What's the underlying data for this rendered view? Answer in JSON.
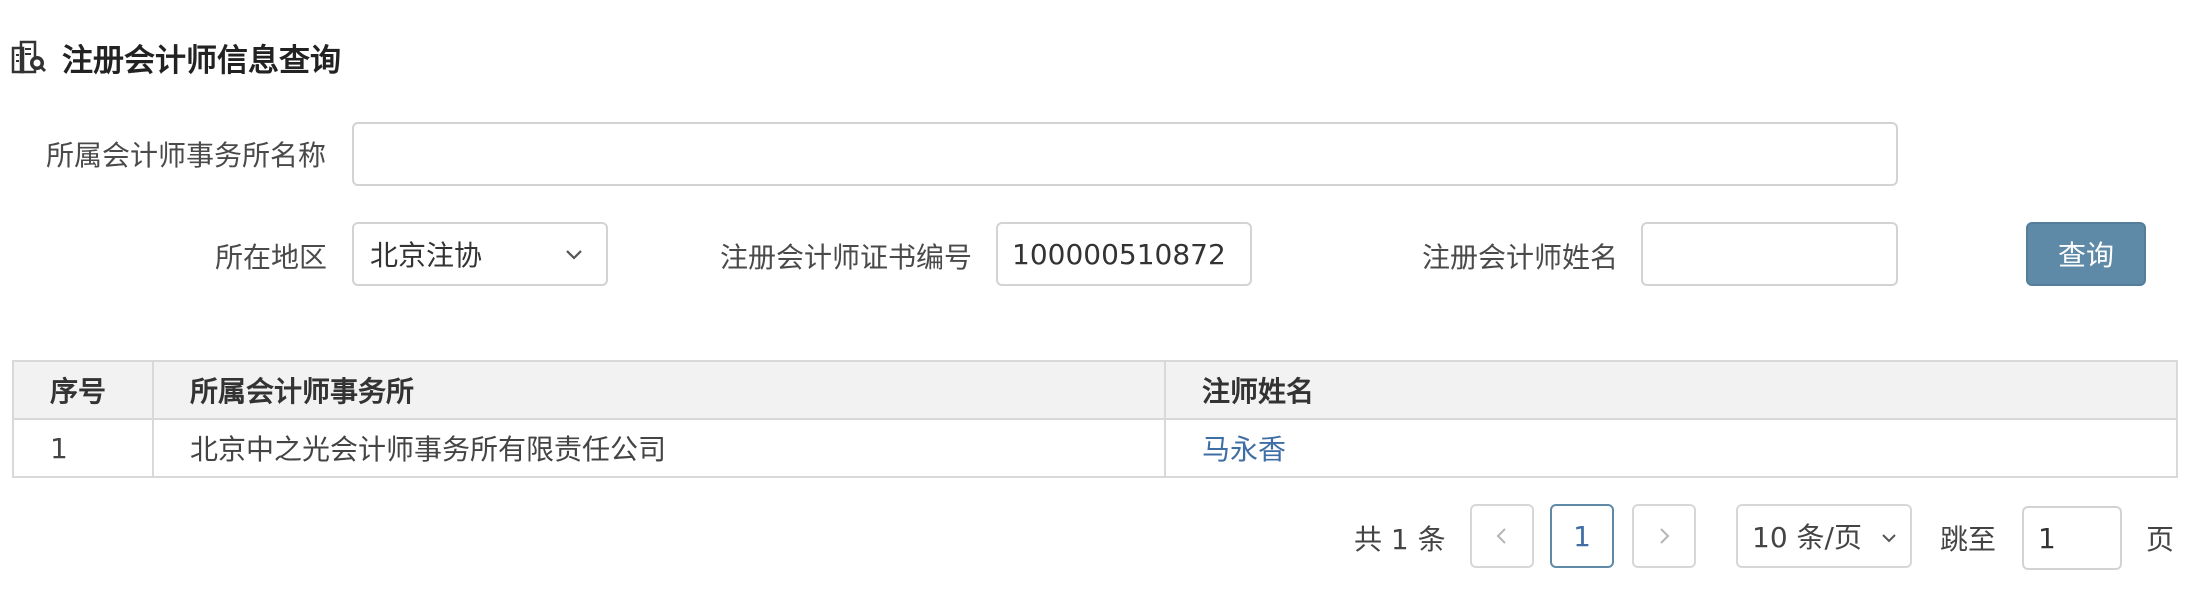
{
  "header": {
    "title": "注册会计师信息查询",
    "icon": "building-search-icon"
  },
  "form": {
    "firm_name_label": "所属会计师事务所名称",
    "firm_name_value": "",
    "region_label": "所在地区",
    "region_value": "北京注协",
    "cert_no_label": "注册会计师证书编号",
    "cert_no_value": "100000510872",
    "cpa_name_label": "注册会计师姓名",
    "cpa_name_value": "",
    "query_label": "查询"
  },
  "table": {
    "headers": [
      "序号",
      "所属会计师事务所",
      "注师姓名"
    ],
    "rows": [
      {
        "index": "1",
        "firm": "北京中之光会计师事务所有限责任公司",
        "name": "马永香"
      }
    ]
  },
  "pagination": {
    "total_text": "共 1 条",
    "current_page": "1",
    "page_size": "10 条/页",
    "jump_label": "跳至",
    "jump_value": "1",
    "page_unit": "页"
  },
  "colors": {
    "accent": "#5e8aa8",
    "link": "#3f6ea5",
    "header_bg": "#f2f2f2",
    "border": "#d9d9d9"
  }
}
